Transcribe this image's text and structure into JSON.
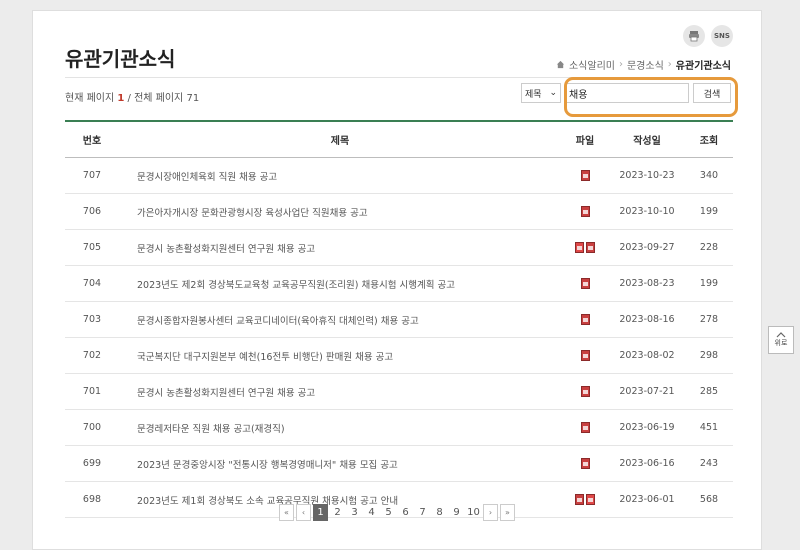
{
  "header": {
    "title": "유관기관소식",
    "util_icons": [
      {
        "name": "print-icon",
        "label": ""
      },
      {
        "name": "sns-icon",
        "label": "SNS"
      }
    ],
    "breadcrumb": [
      "소식알리미",
      "문경소식",
      "유관기관소식"
    ]
  },
  "page_info": {
    "prefix": "현재 페이지",
    "current": "1",
    "middle": "/ 전체 페이지",
    "total": "71"
  },
  "search": {
    "field": "제목",
    "query": "채용",
    "button": "검색"
  },
  "table": {
    "columns": [
      "번호",
      "제목",
      "파일",
      "작성일",
      "조회"
    ],
    "rows": [
      {
        "no": "707",
        "title": "문경시장애인체육회 직원 채용 공고",
        "files": [
          "doc"
        ],
        "date": "2023-10-23",
        "views": "340"
      },
      {
        "no": "706",
        "title": "가은아자개시장 문화관광형시장 육성사업단 직원채용 공고",
        "files": [
          "doc"
        ],
        "date": "2023-10-10",
        "views": "199"
      },
      {
        "no": "705",
        "title": "문경시 농촌활성화지원센터 연구원 채용 공고",
        "files": [
          "pdf",
          "doc"
        ],
        "date": "2023-09-27",
        "views": "228"
      },
      {
        "no": "704",
        "title": "2023년도 제2회 경상북도교육청 교육공무직원(조리원) 채용시험 시행계획 공고",
        "files": [
          "doc"
        ],
        "date": "2023-08-23",
        "views": "199"
      },
      {
        "no": "703",
        "title": "문경시종합자원봉사센터 교육코디네이터(육아휴직 대체인력) 채용 공고",
        "files": [
          "doc"
        ],
        "date": "2023-08-16",
        "views": "278"
      },
      {
        "no": "702",
        "title": "국군복지단 대구지원본부 예천(16전투 비행단) 판매원 채용 공고",
        "files": [
          "doc"
        ],
        "date": "2023-08-02",
        "views": "298"
      },
      {
        "no": "701",
        "title": "문경시 농촌활성화지원센터 연구원 채용 공고",
        "files": [
          "doc"
        ],
        "date": "2023-07-21",
        "views": "285"
      },
      {
        "no": "700",
        "title": "문경레저타운 직원 채용 공고(재경직)",
        "files": [
          "doc"
        ],
        "date": "2023-06-19",
        "views": "451"
      },
      {
        "no": "699",
        "title": "2023년 문경중앙시장 \"전통시장 행복경영매니저\" 채용 모집 공고",
        "files": [
          "doc"
        ],
        "date": "2023-06-16",
        "views": "243"
      },
      {
        "no": "698",
        "title": "2023년도 제1회 경상북도 소속 교육공무직원 채용시험 공고 안내",
        "files": [
          "doc",
          "pdf"
        ],
        "date": "2023-06-01",
        "views": "568"
      }
    ]
  },
  "pagination": {
    "pages": [
      "1",
      "2",
      "3",
      "4",
      "5",
      "6",
      "7",
      "8",
      "9",
      "10"
    ],
    "current": "1"
  },
  "top_button": {
    "label": "위로"
  },
  "colors": {
    "accent_green": "#3a7f53",
    "highlight_orange": "#e69a3c",
    "current_page_red": "#c0392b"
  }
}
